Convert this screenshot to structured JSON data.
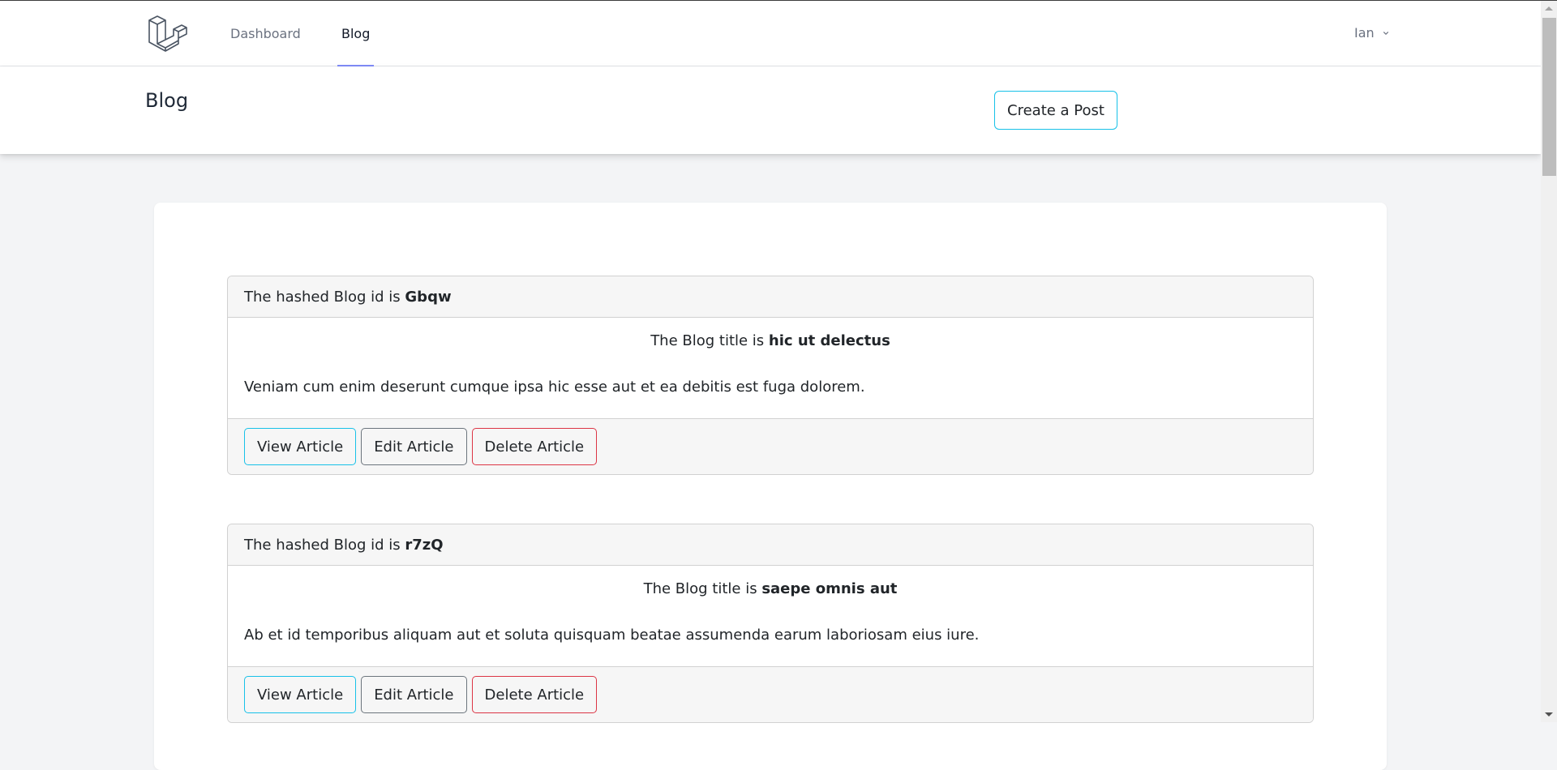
{
  "nav": {
    "logo": "laravel-logo",
    "links": [
      {
        "label": "Dashboard",
        "active": false
      },
      {
        "label": "Blog",
        "active": true
      }
    ],
    "user": {
      "name": "Ian",
      "icon": "chevron-down-icon"
    }
  },
  "header": {
    "title": "Blog",
    "create_button": "Create a Post"
  },
  "posts": [
    {
      "id_prefix": "The hashed Blog id is ",
      "hashed_id": "Gbqw",
      "title_prefix": "The Blog title is ",
      "title": "hic ut delectus",
      "excerpt": "Veniam cum enim deserunt cumque ipsa hic esse aut et ea debitis est fuga dolorem.",
      "actions": {
        "view": "View Article",
        "edit": "Edit Article",
        "delete": "Delete Article"
      }
    },
    {
      "id_prefix": "The hashed Blog id is ",
      "hashed_id": "r7zQ",
      "title_prefix": "The Blog title is ",
      "title": "saepe omnis aut",
      "excerpt": "Ab et id temporibus aliquam aut et soluta quisquam beatae assumenda earum laboriosam eius iure.",
      "actions": {
        "view": "View Article",
        "edit": "Edit Article",
        "delete": "Delete Article"
      }
    }
  ],
  "colors": {
    "accent_info": "#17c1e8",
    "accent_secondary": "#6c757d",
    "accent_danger": "#dc3545",
    "nav_active_underline": "#818cf8",
    "page_bg": "#f3f4f6"
  }
}
